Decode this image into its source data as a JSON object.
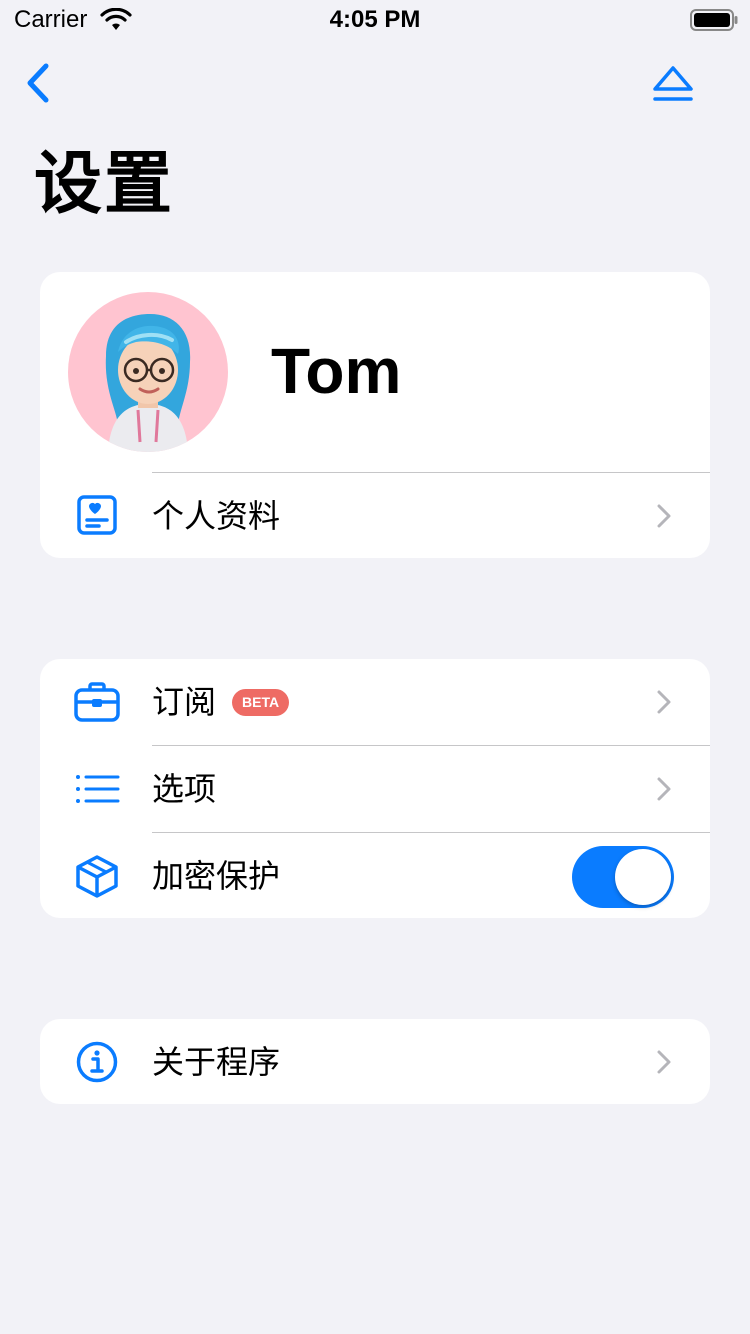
{
  "status_bar": {
    "carrier": "Carrier",
    "time": "4:05 PM"
  },
  "nav": {
    "title": "设置"
  },
  "profile": {
    "name": "Tom",
    "details_label": "个人资料"
  },
  "section_two": {
    "subscription_label": "订阅",
    "subscription_badge": "BETA",
    "options_label": "选项",
    "encryption_label": "加密保护",
    "encryption_enabled": true
  },
  "section_three": {
    "about_label": "关于程序"
  },
  "colors": {
    "accent": "#0a7cff",
    "badge": "#ee6b64",
    "background": "#f2f2f7",
    "avatar_bg": "#ffc4d0"
  },
  "icons": {
    "back": "chevron-left-icon",
    "eject": "eject-icon",
    "profile": "id-card-icon",
    "subscription": "briefcase-icon",
    "options": "list-icon",
    "encryption": "cube-icon",
    "about": "info-circle-icon",
    "disclosure": "chevron-right-icon"
  }
}
